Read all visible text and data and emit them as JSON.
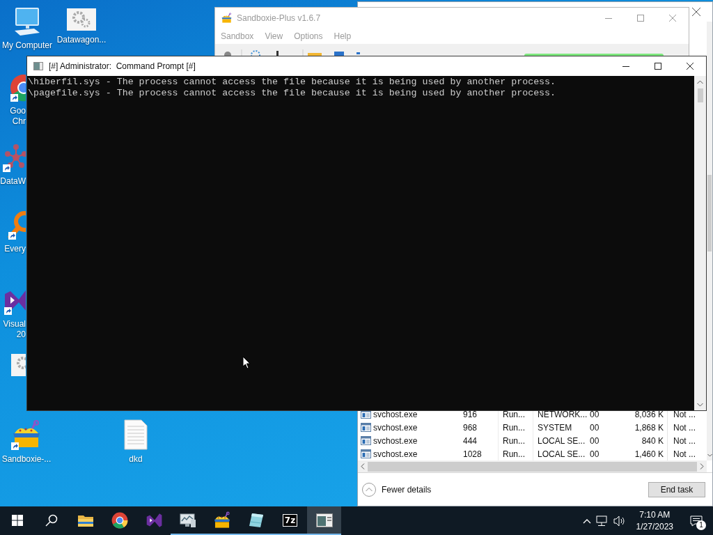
{
  "desktop_icons": [
    {
      "kind": "computer",
      "label": [
        "My Computer"
      ],
      "shortcut": false
    },
    {
      "kind": "settings-app",
      "label": [
        "Datawagon..."
      ],
      "shortcut": false
    },
    {
      "kind": "chrome",
      "label": [
        "Goo",
        "Chr"
      ],
      "shortcut": true
    },
    {
      "kind": "molecule",
      "label": [
        "DataW"
      ],
      "shortcut": true
    },
    {
      "kind": "search-app",
      "label": [
        "Every"
      ],
      "shortcut": true
    },
    {
      "kind": "studio",
      "label": [
        "Visual",
        "20"
      ],
      "shortcut": true
    },
    {
      "kind": "settings-app",
      "shortcut": false
    },
    {
      "kind": "sandbox",
      "label": [
        "Sandboxie-..."
      ],
      "shortcut": true
    },
    {
      "kind": "document",
      "label": [
        "dkd"
      ],
      "shortcut": false
    }
  ],
  "task_manager": {
    "rows": [
      {
        "cells": [
          "svchost.exe",
          "916",
          "Run...",
          "NETWORK...",
          "00",
          "8,036 K",
          "Not ..."
        ]
      },
      {
        "cells": [
          "svchost.exe",
          "968",
          "Run...",
          "SYSTEM",
          "00",
          "1,868 K",
          "Not ..."
        ]
      },
      {
        "cells": [
          "svchost.exe",
          "444",
          "Run...",
          "LOCAL SE...",
          "00",
          "840 K",
          "Not ..."
        ]
      },
      {
        "cells": [
          "svchost.exe",
          "1028",
          "Run...",
          "LOCAL SE...",
          "00",
          "1,460 K",
          "Not ..."
        ]
      }
    ],
    "fewer_details": "Fewer details",
    "end_task": "End task"
  },
  "sandboxie": {
    "title": "Sandboxie-Plus v1.6.7",
    "active": false,
    "menu": [
      "Sandbox",
      "View",
      "Options",
      "Help"
    ]
  },
  "command_prompt": {
    "title": "[#] Administrator:  Command Prompt [#]",
    "active": true,
    "lines": [
      "\\hiberfil.sys - The process cannot access the file because it is being used by another process.",
      "\\pagefile.sys - The process cannot access the file because it is being used by another process."
    ]
  },
  "taskbar": {
    "items": [
      {
        "kind": "start",
        "running": false,
        "active": false
      },
      {
        "kind": "search",
        "running": false,
        "active": false
      },
      {
        "kind": "folder",
        "running": false,
        "active": false
      },
      {
        "kind": "chrome",
        "running": false,
        "active": false
      },
      {
        "kind": "studio",
        "running": false,
        "active": false
      },
      {
        "kind": "monitor",
        "running": true,
        "active": false
      },
      {
        "kind": "sandbox",
        "running": true,
        "active": false
      },
      {
        "kind": "notebook",
        "running": true,
        "active": false
      },
      {
        "kind": "archiver",
        "label": "7z",
        "running": true,
        "active": false
      },
      {
        "kind": "console",
        "running": true,
        "active": true
      }
    ],
    "time": "7:10 AM",
    "date": "1/27/2023",
    "notification_count": "1"
  }
}
